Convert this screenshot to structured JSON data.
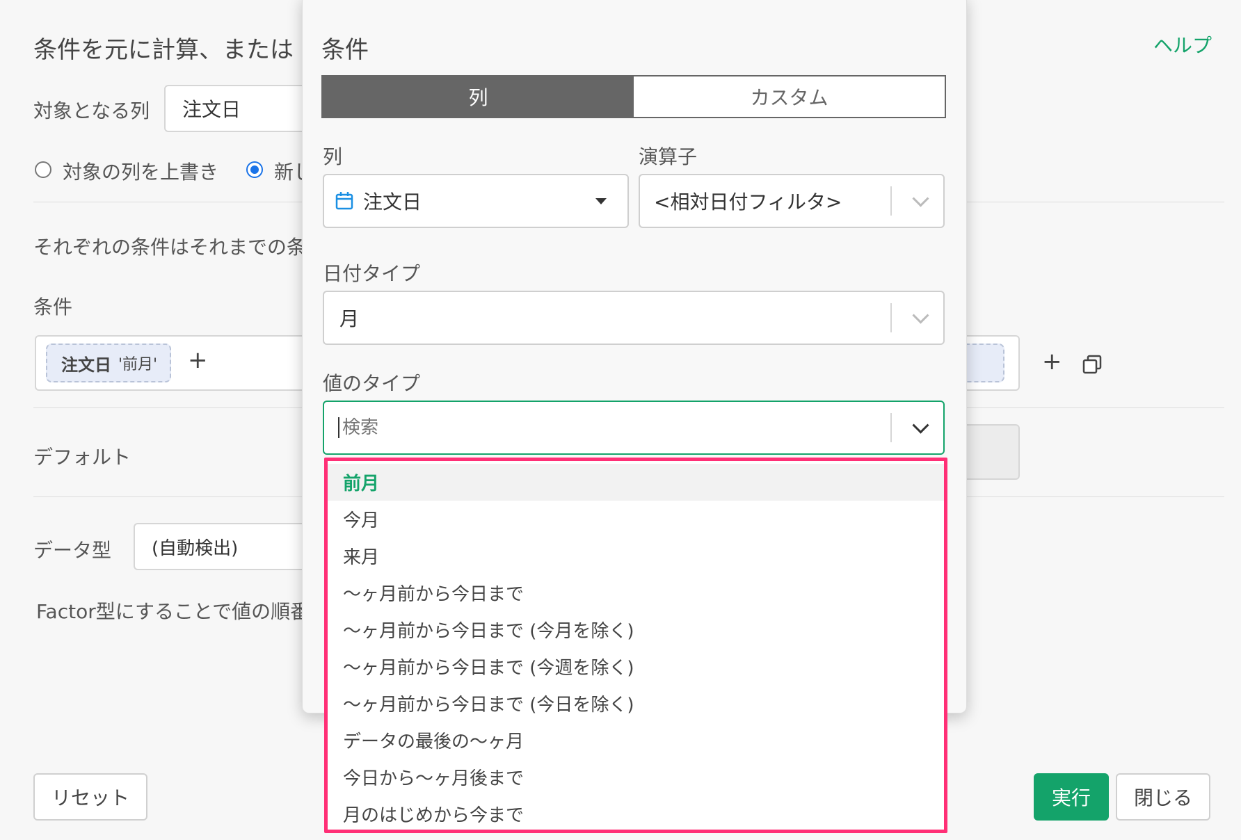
{
  "header": {
    "title": "条件を元に計算、または",
    "help": "ヘルプ"
  },
  "target": {
    "label": "対象となる列",
    "value": "注文日"
  },
  "output": {
    "overwrite_label": "対象の列を上書き",
    "new_label": "新し"
  },
  "description": "それぞれの条件はそれまでの条",
  "conditions": {
    "label": "条件",
    "chip_column": "注文日",
    "chip_value": "'前月'",
    "add": "+"
  },
  "default": {
    "label": "デフォルト"
  },
  "data_type": {
    "label": "データ型",
    "value": "(自動検出)"
  },
  "factor_note": "Factor型にすることで値の順番",
  "buttons": {
    "reset": "リセット",
    "run": "実行",
    "close": "閉じる"
  },
  "modal": {
    "title": "条件",
    "tabs": [
      "列",
      "カスタム"
    ],
    "column_label": "列",
    "column_value": "注文日",
    "operator_label": "演算子",
    "operator_value": "<相対日付フィルタ>",
    "date_type_label": "日付タイプ",
    "date_type_value": "月",
    "value_type_label": "値のタイプ",
    "search_placeholder": "検索",
    "options": [
      "前月",
      "今月",
      "来月",
      "〜ヶ月前から今日まで",
      "〜ヶ月前から今日まで (今月を除く)",
      "〜ヶ月前から今日まで (今週を除く)",
      "〜ヶ月前から今日まで (今日を除く)",
      "データの最後の〜ヶ月",
      "今日から〜ヶ月後まで",
      "月のはじめから今まで"
    ]
  },
  "colors": {
    "accent": "#14a36a",
    "highlight_border": "#ff2f76",
    "radio": "#1a73e8"
  }
}
